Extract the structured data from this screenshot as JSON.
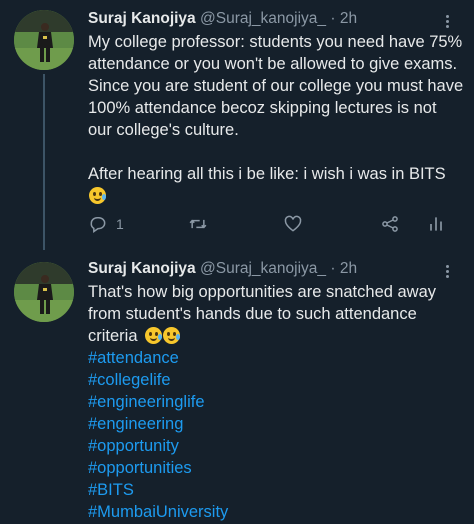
{
  "tweets": [
    {
      "name": "Suraj Kanojiya",
      "handle": "@Suraj_kanojiya_",
      "separator": "·",
      "time": "2h",
      "lines": [
        "My college professor: students you need have 75%",
        "attendance or you won't be allowed to give exams.",
        "Since you are student of our college you must have",
        "100% attendance becoz skipping lectures is not",
        "our college's culture."
      ],
      "line_after": "After hearing all this i be like: i wish i was in BITS",
      "emoji_line": "🥲",
      "reply_count": "1"
    },
    {
      "name": "Suraj Kanojiya",
      "handle": "@Suraj_kanojiya_",
      "separator": "·",
      "time": "2h",
      "lines": [
        "That's how big opportunities are snatched away",
        "from student's hands due to such attendance",
        "criteria"
      ],
      "emojis": "🥲🥲",
      "hashtags": [
        "#attendance",
        "#collegelife",
        "#engineeringlife",
        "#engineering",
        "#opportunity",
        "#opportunities",
        "#BITS",
        "#MumbaiUniversity"
      ]
    }
  ],
  "colors": {
    "background": "#15202b",
    "text": "#e7e9ea",
    "muted": "#8b98a5",
    "link": "#1d9bf0"
  },
  "icons": [
    "more-icon",
    "reply-icon",
    "retweet-icon",
    "like-icon",
    "share-icon",
    "analytics-icon"
  ]
}
